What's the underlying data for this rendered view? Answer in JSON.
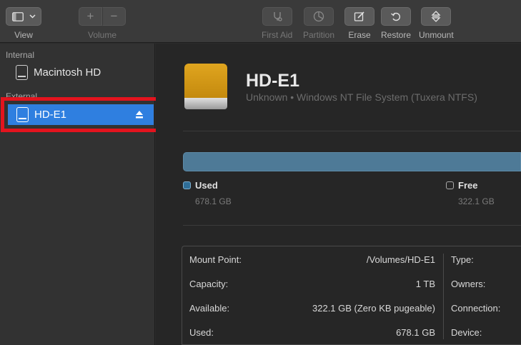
{
  "toolbar": {
    "view_label": "View",
    "volume_label": "Volume",
    "volume_add": "+",
    "volume_remove": "−",
    "actions": [
      {
        "name": "first-aid-button",
        "label": "First Aid",
        "icon": "stethoscope-icon",
        "enabled": false
      },
      {
        "name": "partition-button",
        "label": "Partition",
        "icon": "pie-icon",
        "enabled": false
      },
      {
        "name": "erase-button",
        "label": "Erase",
        "icon": "pencil-icon",
        "enabled": true
      },
      {
        "name": "restore-button",
        "label": "Restore",
        "icon": "undo-arrow-icon",
        "enabled": true
      },
      {
        "name": "unmount-button",
        "label": "Unmount",
        "icon": "unmount-icon",
        "enabled": true
      }
    ]
  },
  "sidebar": {
    "internal_header": "Internal",
    "internal_disk": "Macintosh HD",
    "external_header": "External",
    "selected_disk": "HD-E1"
  },
  "disk": {
    "name": "HD-E1",
    "subtitle": "Unknown • Windows NT File System (Tuxera NTFS)",
    "used_label": "Used",
    "used_value": "678.1 GB",
    "free_label": "Free",
    "free_value": "322.1 GB",
    "used_fraction": 0.678
  },
  "info": {
    "mount_point_key": "Mount Point:",
    "mount_point_val": "/Volumes/HD-E1",
    "capacity_key": "Capacity:",
    "capacity_val": "1 TB",
    "available_key": "Available:",
    "available_val": "322.1 GB (Zero KB pugeable)",
    "used_key": "Used:",
    "used_val": "678.1 GB",
    "type_key": "Type:",
    "owners_key": "Owners:",
    "connection_key": "Connection:",
    "device_key": "Device:"
  },
  "colors": {
    "selection": "#2f7fe0",
    "highlight_box": "#e3141e",
    "used_bar": "#4e7a97",
    "disk_gold": "#d89b16"
  }
}
